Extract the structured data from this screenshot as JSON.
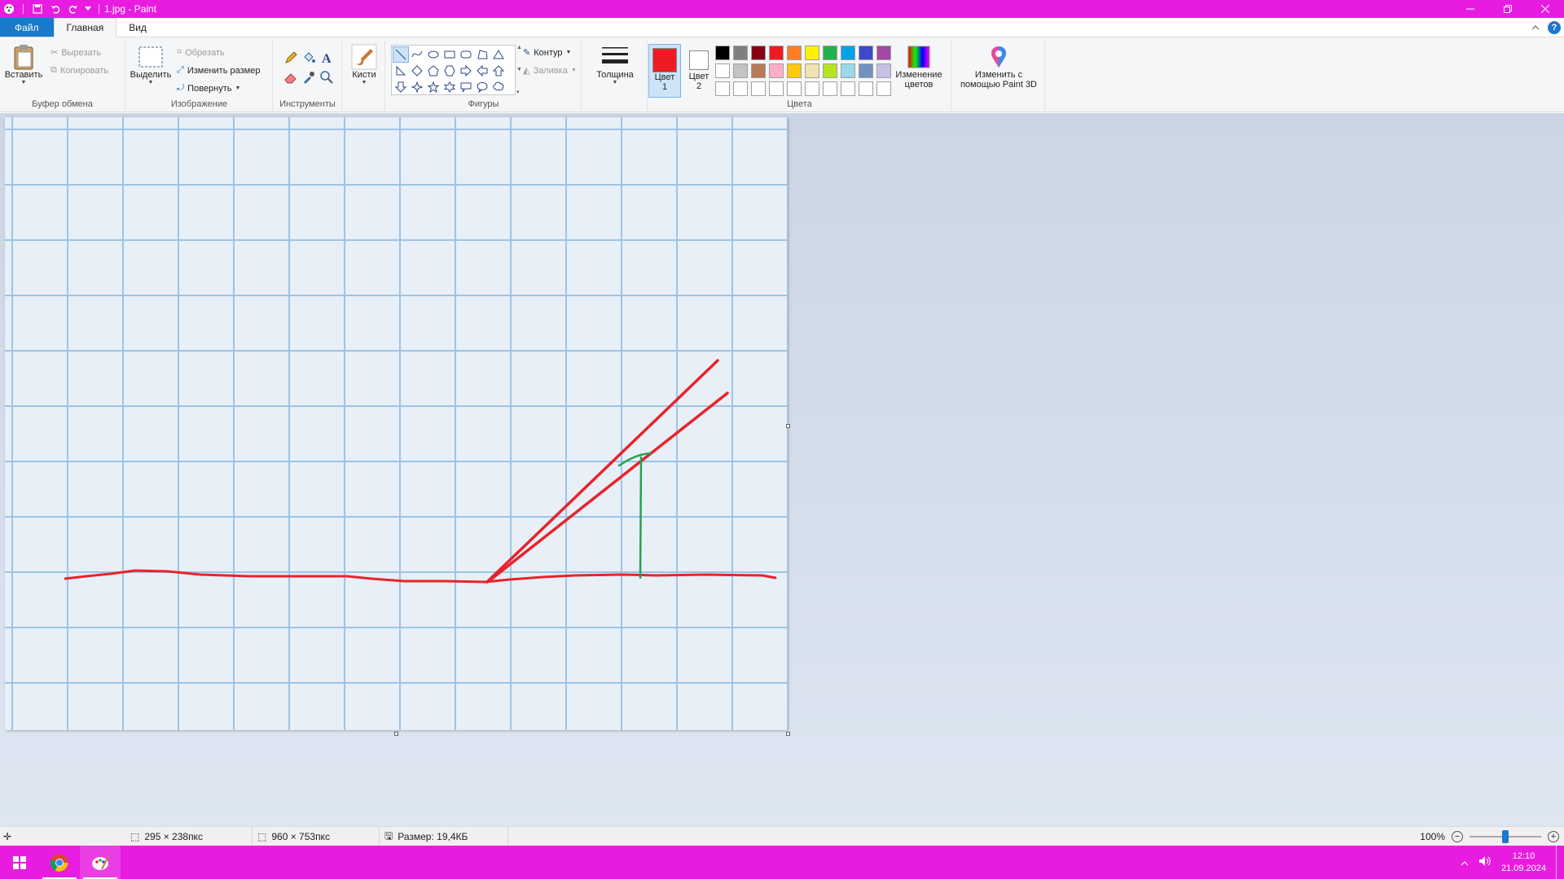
{
  "window": {
    "title": "1.jpg - Paint"
  },
  "tabs": {
    "file": "Файл",
    "home": "Главная",
    "view": "Вид"
  },
  "clipboard": {
    "paste": "Вставить",
    "cut": "Вырезать",
    "copy": "Копировать",
    "label": "Буфер обмена"
  },
  "image": {
    "select": "Выделить",
    "crop": "Обрезать",
    "resize": "Изменить размер",
    "rotate": "Повернуть",
    "label": "Изображение"
  },
  "tools": {
    "label": "Инструменты"
  },
  "brushes": {
    "label": "Кисти"
  },
  "shapes": {
    "outline": "Контур",
    "fill": "Заливка",
    "label": "Фигуры"
  },
  "size": {
    "label": "Толщина"
  },
  "colors": {
    "color1_line1": "Цвет",
    "color1_line2": "1",
    "color2_line1": "Цвет",
    "color2_line2": "2",
    "label": "Цвета",
    "edit_line1": "Изменение",
    "edit_line2": "цветов",
    "color1": "#ed1c24",
    "color2": "#ffffff",
    "palette_row1": [
      "#000000",
      "#7f7f7f",
      "#880015",
      "#ed1c24",
      "#ff7f27",
      "#fff200",
      "#22b14c",
      "#00a2e8",
      "#3f48cc",
      "#a349a4"
    ],
    "palette_row2": [
      "#ffffff",
      "#c3c3c3",
      "#b97a57",
      "#ffaec9",
      "#ffc90e",
      "#efe4b0",
      "#b5e61d",
      "#99d9ea",
      "#7092be",
      "#c8bfe7"
    ]
  },
  "paint3d": {
    "line1": "Изменить с",
    "line2": "помощью Paint 3D"
  },
  "status": {
    "cursor": "295 × 238пкс",
    "dimensions": "960 × 753пкс",
    "file_size": "Размер: 19,4КБ",
    "zoom": "100%",
    "zoom_fraction": 0.5
  },
  "clock": {
    "time": "12:10",
    "date": "21.09.2024"
  },
  "icons": [
    "paint-app-icon",
    "save-icon",
    "undo-icon",
    "redo-icon",
    "minimize-icon",
    "restore-icon",
    "close-icon",
    "help-icon",
    "windows-start-icon",
    "chrome-icon",
    "paint-taskbar-icon"
  ]
}
